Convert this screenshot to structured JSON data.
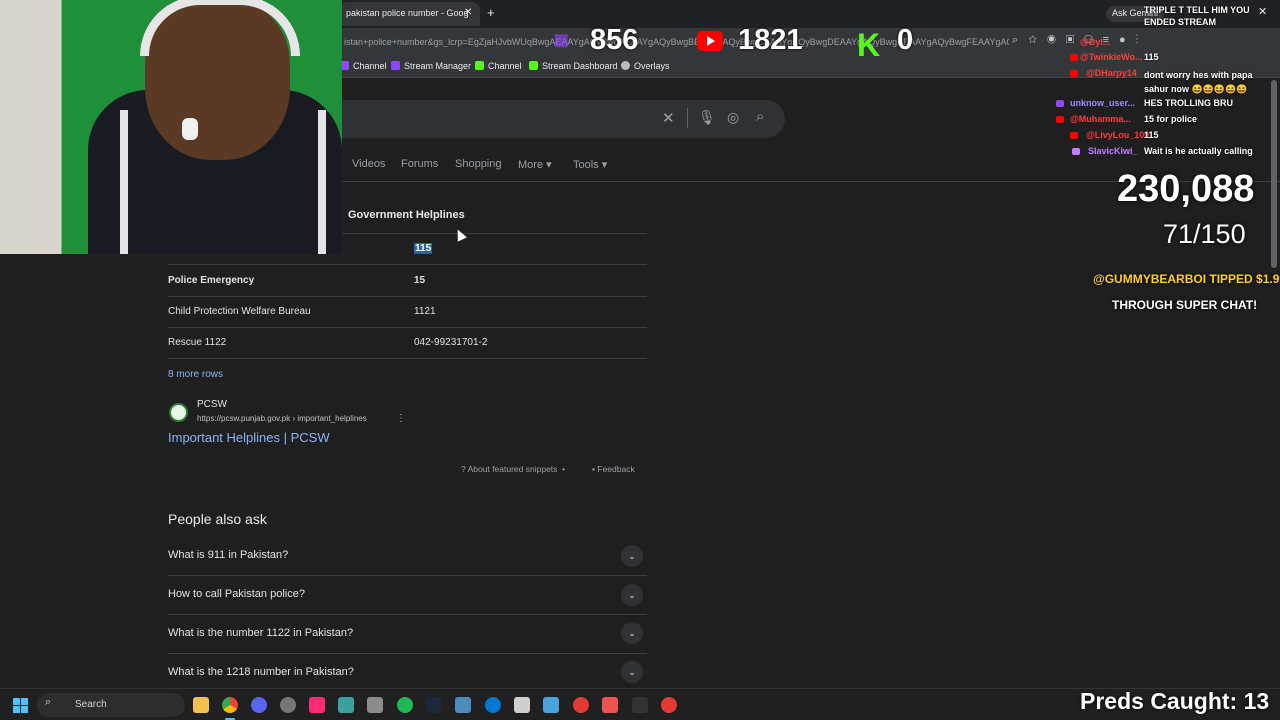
{
  "browser": {
    "tab_title": "pakistan police number - Goog",
    "tab_close": "✕",
    "new_tab": "+",
    "ask_gemini": "Ask Gemini",
    "url": "istan+police+number&gs_lcrp=EgZjaHJvbWUqBwgAEAAYgAQyBwgAEAAYgAQyBwgBEAAYgAQyBwgCEAAYgAQyBwgDEAAYgAQyBwgEEAAYgAQyBwgFEAAYgAQyCAgGEAAYFhg",
    "bookmarks": [
      "Channel",
      "Stream Manager",
      "Channel",
      "Stream Dashboard",
      "Overlays"
    ]
  },
  "search": {
    "nav_items": [
      "Videos",
      "Forums",
      "Shopping",
      "More",
      "Tools"
    ]
  },
  "snippet": {
    "table_header": "Government Helplines",
    "rows": [
      {
        "name": "",
        "number": "115"
      },
      {
        "name": "Police Emergency",
        "number": "15"
      },
      {
        "name": "Child Protection Welfare Bureau",
        "number": "1121"
      },
      {
        "name": "Rescue 1122",
        "number": "042-99231701-2"
      }
    ],
    "more_rows": "8 more rows",
    "source_name": "PCSW",
    "source_url": "https://pcsw.punjab.gov.pk › important_helplines",
    "result_title": "Important Helplines | PCSW",
    "about": "About featured snippets",
    "feedback": "Feedback"
  },
  "people_also_ask": {
    "title": "People also ask",
    "questions": [
      "What is 911 in Pakistan?",
      "How to call Pakistan police?",
      "What is the number 1122 in Pakistan?",
      "What is the 1218 number in Pakistan?"
    ]
  },
  "overlay": {
    "twitch_viewers": "856",
    "youtube_viewers": "1821",
    "kick_icon": "K",
    "kick_viewers": "0",
    "sub_count": "230,088",
    "goal": "71/150",
    "tip_line1": "@GUMMYBEARBOI TIPPED $1.99",
    "tip_line2": "THROUGH SUPER CHAT!",
    "preds_caught": "Preds Caught: 13"
  },
  "chat": [
    {
      "user": "@Dyl...",
      "message": "TRIPLE T TELL HIM YOU ENDED STREAM",
      "color": "#ff3b3b"
    },
    {
      "user": "@TwinkieWo...",
      "message": "115",
      "color": "#ff3b3b"
    },
    {
      "user": "@DHarpy14",
      "message": "dont worry hes with papa sahur now 😆😆😆😆😆",
      "color": "#ff3b3b"
    },
    {
      "user": "unknow_user...",
      "message": "HES TROLLING BRU",
      "color": "#9b8cff"
    },
    {
      "user": "@Muhamma...",
      "message": "15 for police",
      "color": "#ff3b3b"
    },
    {
      "user": "@LivyLou_100",
      "message": "115",
      "color": "#ff3b3b"
    },
    {
      "user": "SlavicKiwi_",
      "message": "Wait is he actually calling",
      "color": "#c77dff"
    }
  ],
  "taskbar": {
    "search_label": "Search"
  },
  "colors": {
    "link": "#8ab4f8",
    "twitch": "#9146ff",
    "youtube": "#ff0000",
    "kick": "#53fc18"
  }
}
